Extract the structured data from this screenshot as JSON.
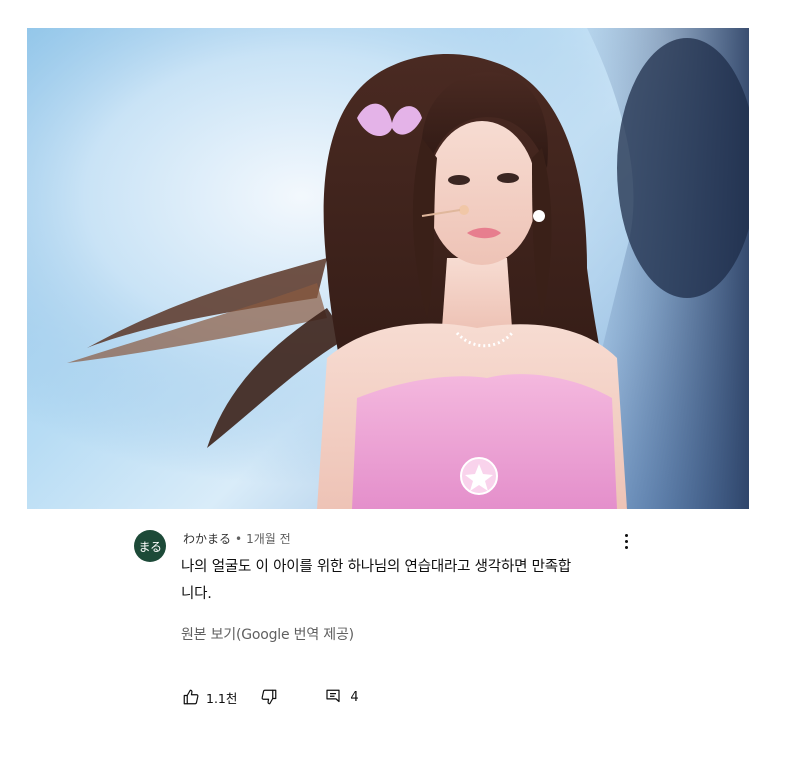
{
  "photo": {
    "description_icon": "performer-photo"
  },
  "comment": {
    "avatar_text": "まる",
    "author": "わかまる",
    "separator": "•",
    "time": "1개월 전",
    "text": "나의 얼굴도 이 아이를 위한 하나님의 연습대라고 생각하면 만족합니다.",
    "translate_link": "원본 보기(Google 번역 제공)",
    "like_count": "1.1천",
    "reply_count": "4",
    "colors": {
      "avatar_bg": "#1d4a38",
      "secondary_text": "#606060"
    },
    "icons": {
      "like": "thumbs-up-icon",
      "dislike": "thumbs-down-icon",
      "reply": "reply-comment-icon",
      "more": "more-vertical-icon"
    }
  }
}
